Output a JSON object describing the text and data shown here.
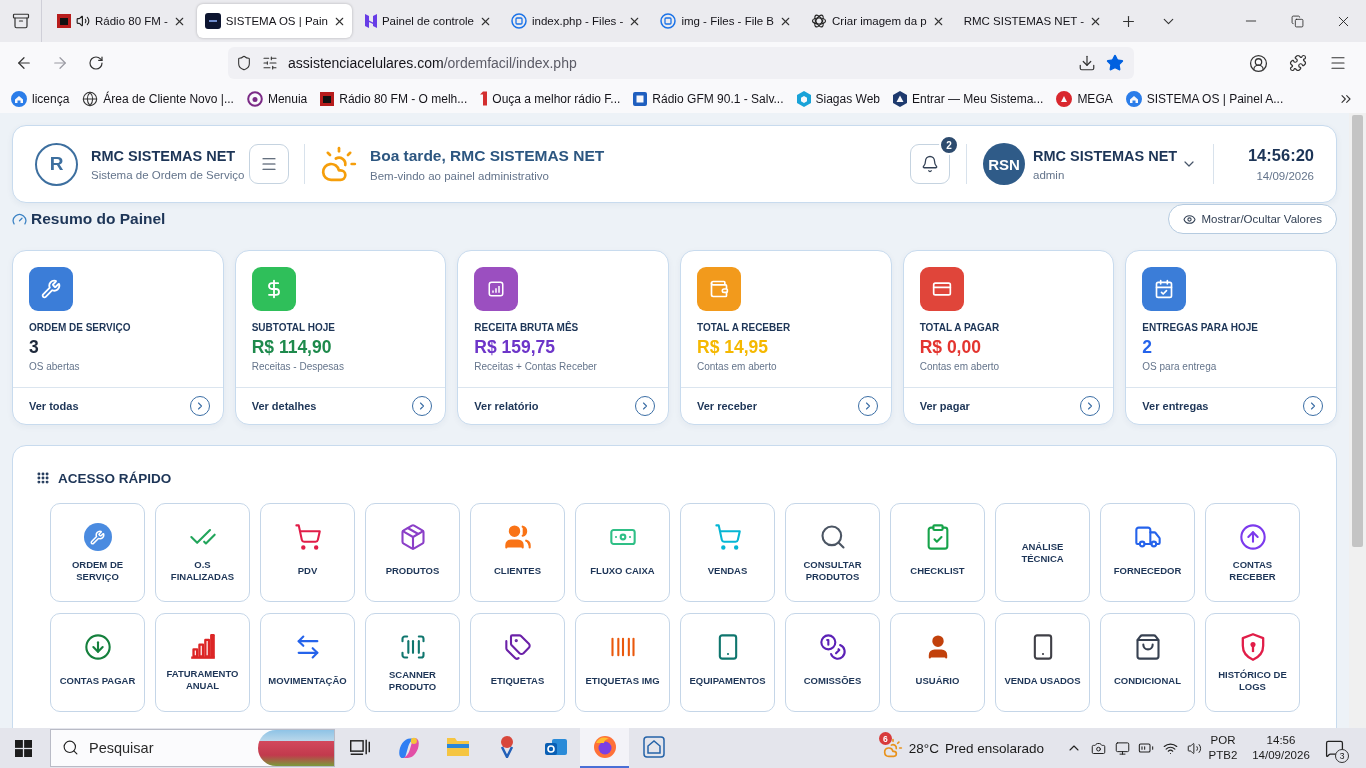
{
  "browser": {
    "tabs": [
      {
        "title": "Rádio 80 FM -",
        "selected": false,
        "playing": true
      },
      {
        "title": "SISTEMA OS | Pain",
        "selected": true,
        "playing": false
      },
      {
        "title": "Painel de controle",
        "selected": false,
        "playing": false
      },
      {
        "title": "index.php - Files -",
        "selected": false,
        "playing": false
      },
      {
        "title": "img - Files - File B",
        "selected": false,
        "playing": false
      },
      {
        "title": "Criar imagem da p",
        "selected": false,
        "playing": false
      },
      {
        "title": "RMC SISTEMAS NET -",
        "selected": false,
        "playing": false
      }
    ],
    "address": {
      "host": "assistenciacelulares.com",
      "path": "/ordemfacil/index.php"
    },
    "bookmarked": true,
    "bookmarks": [
      {
        "label": "licença"
      },
      {
        "label": "Área de Cliente Novo |..."
      },
      {
        "label": "Menuia"
      },
      {
        "label": "Rádio 80 FM - O melh..."
      },
      {
        "label": "Ouça a melhor rádio F..."
      },
      {
        "label": "Rádio GFM 90.1 - Salv..."
      },
      {
        "label": "Siagas Web"
      },
      {
        "label": "Entrar — Meu Sistema..."
      },
      {
        "label": "MEGA"
      },
      {
        "label": "SISTEMA OS | Painel A..."
      }
    ]
  },
  "header": {
    "logo": "R",
    "brand": "RMC SISTEMAS NET",
    "tagline": "Sistema de Ordem de Serviço",
    "greeting": "Boa tarde, RMC SISTEMAS NET",
    "welcome": "Bem-vindo ao painel administrativo",
    "notification_count": "2",
    "user": {
      "initials": "RSN",
      "name": "RMC SISTEMAS NET",
      "role": "admin"
    },
    "time": "14:56:20",
    "date": "14/09/2026"
  },
  "summary": {
    "title": "Resumo do Painel",
    "toggle_button": "Mostrar/Ocultar Valores",
    "cards": [
      {
        "label": "ORDEM DE SERVIÇO",
        "value": {
          "text": "3",
          "color": "#1e293b"
        },
        "note": "OS abertas",
        "link": "Ver todas",
        "color": "#3b7dd8"
      },
      {
        "label": "SUBTOTAL HOJE",
        "value": {
          "text": "R$ 114,90",
          "color": "#1e8a4c"
        },
        "note": "Receitas - Despesas",
        "link": "Ver detalhes",
        "color": "#2fbf5a"
      },
      {
        "label": "RECEITA BRUTA MÊS",
        "value": {
          "text": "R$ 159,75",
          "color": "#6d35c9"
        },
        "note": "Receitas + Contas Receber",
        "link": "Ver relatório",
        "color": "#9b4fc0"
      },
      {
        "label": "TOTAL A RECEBER",
        "value": {
          "text": "R$ 14,95",
          "color": "#f5b800"
        },
        "note": "Contas em aberto",
        "link": "Ver receber",
        "color": "#f29a1c"
      },
      {
        "label": "TOTAL A PAGAR",
        "value": {
          "text": "R$ 0,00",
          "color": "#e3342f"
        },
        "note": "Contas em aberto",
        "link": "Ver pagar",
        "color": "#e0453a"
      },
      {
        "label": "ENTREGAS PARA HOJE",
        "value": {
          "text": "2",
          "color": "#2563eb"
        },
        "note": "OS para entrega",
        "link": "Ver entregas",
        "color": "#3b7dd8"
      }
    ]
  },
  "quick_access": {
    "title": "ACESSO RÁPIDO",
    "tiles": [
      {
        "label": "ORDEM DE SERVIÇO",
        "color": "#4a8be0"
      },
      {
        "label": "O.S FINALIZADAS",
        "color": "#22a55b"
      },
      {
        "label": "PDV",
        "color": "#e11d48"
      },
      {
        "label": "PRODUTOS",
        "color": "#8b3fc8"
      },
      {
        "label": "CLIENTES",
        "color": "#f97316"
      },
      {
        "label": "FLUXO CAIXA",
        "color": "#2fbf86"
      },
      {
        "label": "VENDAS",
        "color": "#06b6d4"
      },
      {
        "label": "CONSULTAR PRODUTOS",
        "color": "#4b5563"
      },
      {
        "label": "CHECKLIST",
        "color": "#16a34a"
      },
      {
        "label": "ANÁLISE TÉCNICA"
      },
      {
        "label": "FORNECEDOR",
        "color": "#2563eb"
      },
      {
        "label": "CONTAS RECEBER",
        "color": "#7c3aed"
      },
      {
        "label": "CONTAS PAGAR",
        "color": "#15803d"
      },
      {
        "label": "FATURAMENTO ANUAL",
        "color": "#dc2626"
      },
      {
        "label": "MOVIMENTAÇÃO",
        "color": "#2563eb"
      },
      {
        "label": "SCANNER PRODUTO",
        "color": "#0f766e"
      },
      {
        "label": "ETIQUETAS",
        "color": "#6b21a8"
      },
      {
        "label": "ETIQUETAS IMG",
        "color": "#ea580c"
      },
      {
        "label": "EQUIPAMENTOS",
        "color": "#0f766e"
      },
      {
        "label": "COMISSÕES",
        "color": "#5b21b6"
      },
      {
        "label": "USUÁRIO",
        "color": "#c2410c"
      },
      {
        "label": "VENDA USADOS",
        "color": "#3f3f46"
      },
      {
        "label": "CONDICIONAL",
        "color": "#374151"
      },
      {
        "label": "HISTÓRICO DE LOGS",
        "color": "#e11d48"
      }
    ]
  },
  "taskbar": {
    "search": {
      "placeholder": "Pesquisar"
    },
    "weather_alerts": "6",
    "temperature": "28°C",
    "forecast": "Pred ensolarado",
    "language": "POR",
    "keyboard": "PTB2",
    "time": "14:56",
    "date": "14/09/2026",
    "notifications": "3"
  }
}
